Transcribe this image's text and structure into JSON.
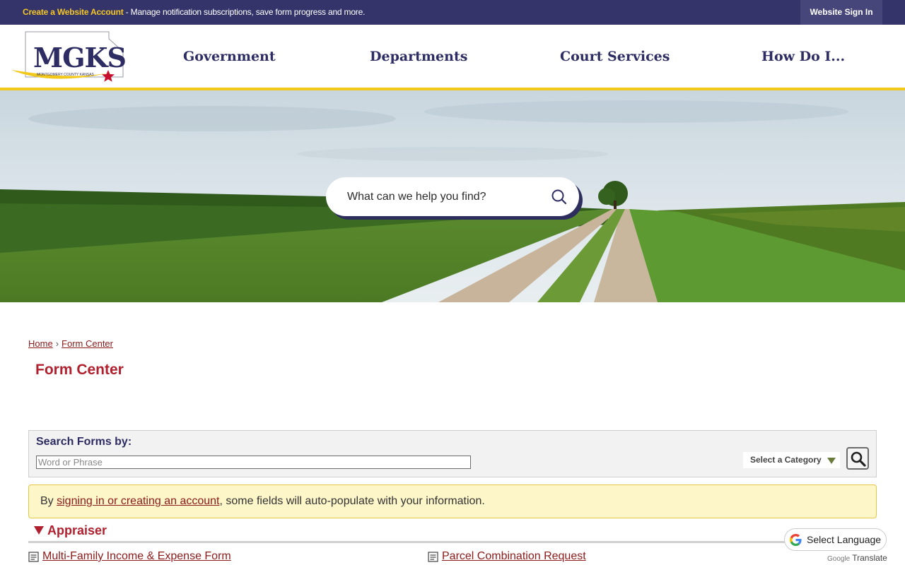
{
  "topbar": {
    "create_account": "Create a Website Account",
    "notice": " - Manage notification subscriptions, save form progress and more.",
    "sign_in": "Website Sign In"
  },
  "logo": {
    "text": "MGKS",
    "subtext": "MONTGOMERY COUNTY KANSAS"
  },
  "nav": [
    {
      "label": "Government"
    },
    {
      "label": "Departments"
    },
    {
      "label": "Court Services"
    },
    {
      "label": "How Do I..."
    }
  ],
  "search": {
    "placeholder": "What can we help you find?"
  },
  "breadcrumb": {
    "home": "Home",
    "separator": "›",
    "current": "Form Center"
  },
  "page_title": "Form Center",
  "search_forms": {
    "label": "Search Forms by:",
    "placeholder": "Word or Phrase",
    "category": "Select a Category"
  },
  "signin_notice": {
    "prefix": "By ",
    "link": "signing in or creating an account",
    "suffix": ", some fields will auto-populate with your information."
  },
  "section": {
    "title": "Appraiser"
  },
  "forms": [
    {
      "label": "Multi-Family Income & Expense Form"
    },
    {
      "label": "Parcel Combination Request"
    }
  ],
  "translate": {
    "label": "Select Language",
    "powered_brand": "Google",
    "powered_text": "Translate"
  },
  "colors": {
    "topbar": "#34346a",
    "nav_text": "#2d2d63",
    "accent_yellow": "#f2c81b",
    "title_red": "#b0202e",
    "link_red": "#8c1a1a"
  }
}
